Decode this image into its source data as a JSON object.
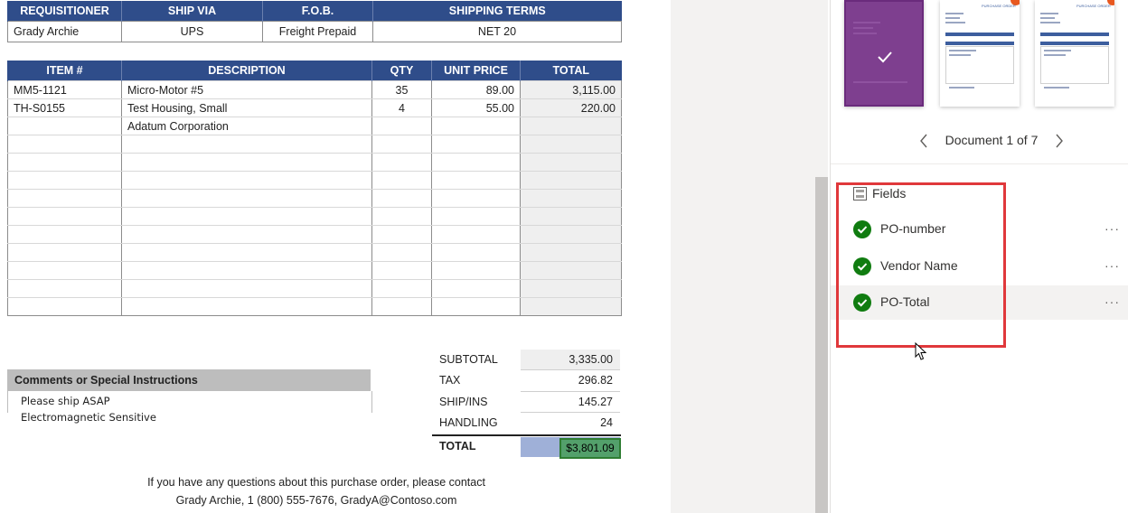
{
  "header_table": {
    "columns": [
      "REQUISITIONER",
      "SHIP VIA",
      "F.O.B.",
      "SHIPPING TERMS"
    ],
    "values": [
      "Grady Archie",
      "UPS",
      "Freight Prepaid",
      "NET 20"
    ]
  },
  "items_table": {
    "columns": [
      "ITEM #",
      "DESCRIPTION",
      "QTY",
      "UNIT PRICE",
      "TOTAL"
    ],
    "rows": [
      [
        "MM5-1121",
        "Micro-Motor #5",
        "35",
        "89.00",
        "3,115.00"
      ],
      [
        "TH-S0155",
        "Test Housing, Small",
        "4",
        "55.00",
        "220.00"
      ],
      [
        "",
        "Adatum Corporation",
        "",
        "",
        ""
      ],
      [
        "",
        "",
        "",
        "",
        ""
      ],
      [
        "",
        "",
        "",
        "",
        ""
      ],
      [
        "",
        "",
        "",
        "",
        ""
      ],
      [
        "",
        "",
        "",
        "",
        ""
      ],
      [
        "",
        "",
        "",
        "",
        ""
      ],
      [
        "",
        "",
        "",
        "",
        ""
      ],
      [
        "",
        "",
        "",
        "",
        ""
      ],
      [
        "",
        "",
        "",
        "",
        ""
      ],
      [
        "",
        "",
        "",
        "",
        ""
      ],
      [
        "",
        "",
        "",
        "",
        ""
      ]
    ]
  },
  "comments": {
    "title": "Comments or Special Instructions",
    "line1": "Please ship ASAP",
    "line2": "Electromagnetic Sensitive"
  },
  "totals": {
    "subtotal_label": "SUBTOTAL",
    "subtotal": "3,335.00",
    "tax_label": "TAX",
    "tax": "296.82",
    "ship_label": "SHIP/INS",
    "ship": "145.27",
    "handling_label": "HANDLING",
    "handling": "24",
    "total_label": "TOTAL",
    "total": "$3,801.09"
  },
  "footer": {
    "line1": "If you have any questions about this purchase order, please contact",
    "line2": "Grady Archie, 1 (800) 555-7676, GradyA@Contoso.com"
  },
  "pane": {
    "thumbnail_title": "PURCHASE ORDER",
    "doc_counter": "Document 1 of 7",
    "fields_title": "Fields",
    "fields": [
      {
        "label": "PO-number",
        "icon": "check-circle-icon",
        "more": "···"
      },
      {
        "label": "Vendor Name",
        "icon": "check-circle-icon",
        "more": "···"
      },
      {
        "label": "PO-Total",
        "icon": "check-circle-icon",
        "more": "···"
      }
    ]
  },
  "colors": {
    "header_blue": "#2f4d8a",
    "selected_thumb": "#7e3f8f",
    "field_ok_green": "#107c10",
    "highlight_red": "#e0383b",
    "total_cell": "#9fb0d8",
    "badge_orange": "#e8581f"
  }
}
